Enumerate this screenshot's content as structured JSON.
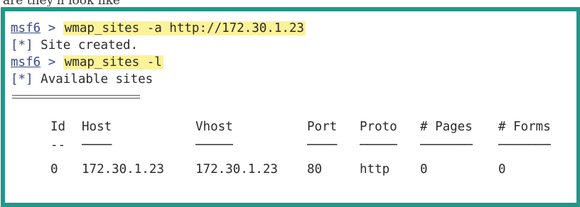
{
  "caption": "are they'll look like",
  "terminal": {
    "prompt": "msf6",
    "prompt_arrow": ">",
    "lines": [
      {
        "type": "command",
        "text": "wmap_sites -a http://172.30.1.23"
      },
      {
        "type": "output",
        "tag": "[*]",
        "text": "Site created."
      },
      {
        "type": "command",
        "text": "wmap_sites -l"
      },
      {
        "type": "output",
        "tag": "[*]",
        "text": "Available sites"
      }
    ]
  },
  "sites_table": {
    "columns": [
      "Id",
      "Host",
      "Vhost",
      "Port",
      "Proto",
      "# Pages",
      "# Forms"
    ],
    "separators": [
      "--",
      "────",
      "─────",
      "────",
      "─────",
      "───────",
      "───────"
    ],
    "rows": [
      [
        "0",
        "172.30.1.23",
        "172.30.1.23",
        "80",
        "http",
        "0",
        "0"
      ]
    ]
  },
  "colors": {
    "frame_border": "#20988a",
    "highlight": "#fbf29a",
    "prompt": "#3a4a8c"
  }
}
